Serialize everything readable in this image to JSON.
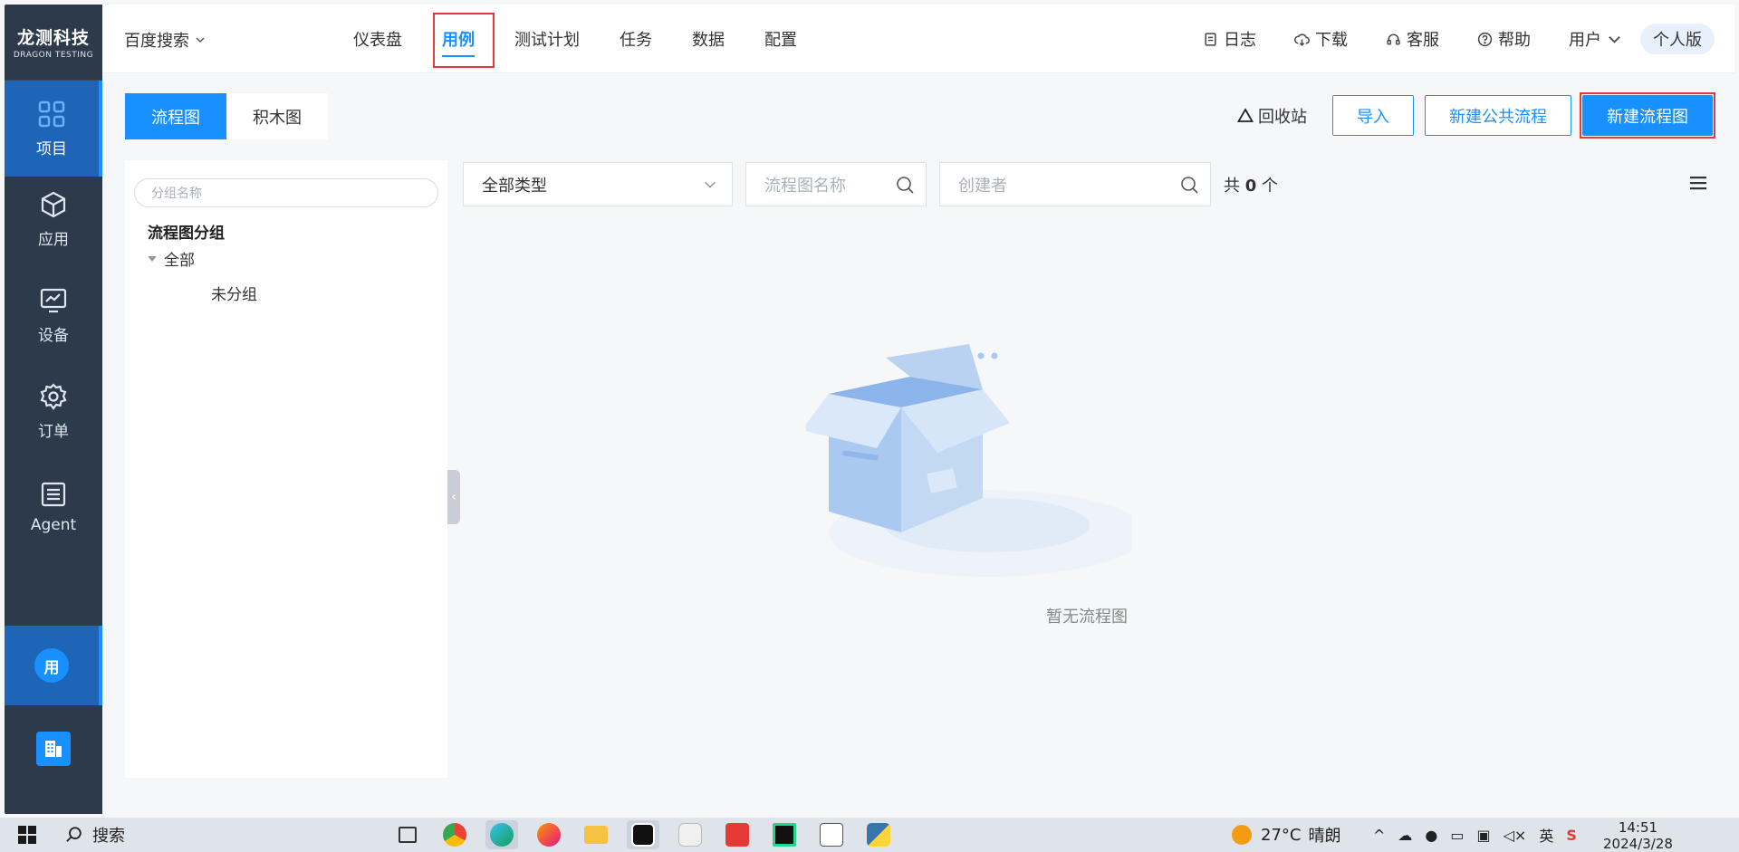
{
  "brand": {
    "name": "龙测科技",
    "sub": "DRAGON TESTING"
  },
  "rail": {
    "items": [
      {
        "label": "项目",
        "icon": "grid-icon",
        "active": true
      },
      {
        "label": "应用",
        "icon": "cube-icon",
        "active": false
      },
      {
        "label": "设备",
        "icon": "monitor-icon",
        "active": false
      },
      {
        "label": "订单",
        "icon": "gear-icon",
        "active": false
      },
      {
        "label": "Agent",
        "icon": "doc-icon",
        "active": false
      }
    ],
    "user_avatar": "用"
  },
  "topbar": {
    "project": "百度搜索",
    "nav": [
      "仪表盘",
      "用例",
      "测试计划",
      "任务",
      "数据",
      "配置"
    ],
    "active_nav": "用例",
    "right": {
      "log": "日志",
      "download": "下载",
      "service": "客服",
      "help": "帮助",
      "user": "用户",
      "edition": "个人版"
    }
  },
  "content": {
    "tabs": [
      "流程图",
      "积木图"
    ],
    "active_tab": "流程图",
    "recycle": "回收站",
    "buttons": {
      "import": "导入",
      "new_public": "新建公共流程",
      "new_flow": "新建流程图"
    },
    "tree": {
      "search_placeholder": "分组名称",
      "title": "流程图分组",
      "all": "全部",
      "ungrouped": "未分组"
    },
    "filters": {
      "type": "全部类型",
      "name_placeholder": "流程图名称",
      "creator_placeholder": "创建者",
      "count_prefix": "共",
      "count": "0",
      "count_suffix": "个"
    },
    "empty_text": "暂无流程图"
  },
  "taskbar": {
    "search": "搜索",
    "temp": "27°C",
    "weather": "晴朗",
    "ime": "英",
    "time": "14:51",
    "date": "2024/3/28"
  },
  "colors": {
    "accent": "#1890ff",
    "rail": "#2d3a4b",
    "highlight": "#e53935"
  }
}
